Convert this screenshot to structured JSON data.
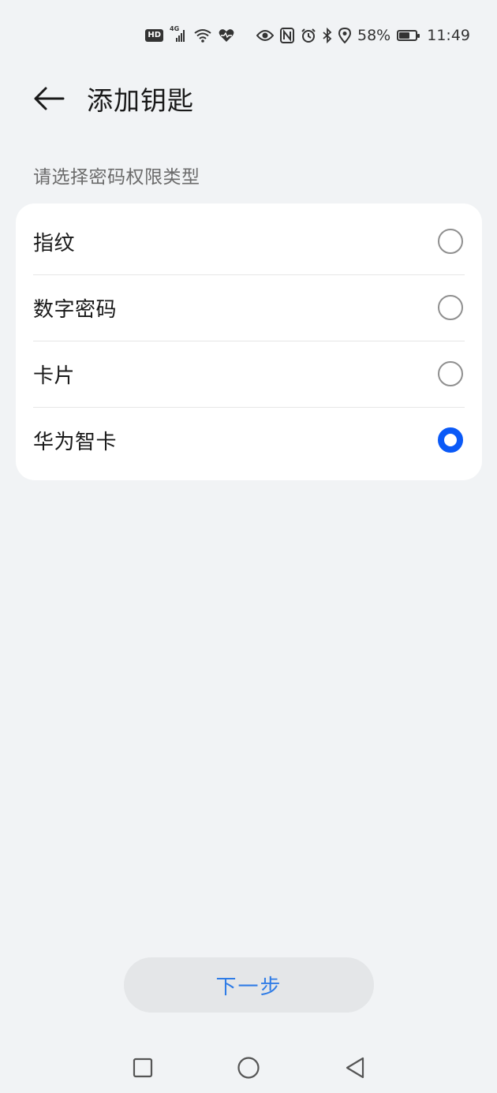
{
  "status_bar": {
    "hd_label": "HD",
    "network_label": "4G",
    "battery_text": "58%",
    "battery_level": 0.58,
    "time": "11:49",
    "icons": [
      "hd-icon",
      "cellular-signal-icon",
      "wifi-icon",
      "health-heart-icon",
      "eye-comfort-icon",
      "nfc-icon",
      "alarm-icon",
      "bluetooth-icon",
      "location-icon",
      "battery-icon"
    ]
  },
  "header": {
    "title": "添加钥匙",
    "back_icon": "arrow-left-icon"
  },
  "section": {
    "label": "请选择密码权限类型"
  },
  "options": [
    {
      "label": "指纹",
      "selected": false
    },
    {
      "label": "数字密码",
      "selected": false
    },
    {
      "label": "卡片",
      "selected": false
    },
    {
      "label": "华为智卡",
      "selected": true
    }
  ],
  "footer": {
    "next_label": "下一步"
  },
  "navigation": {
    "icons": [
      "recent-apps-square-icon",
      "home-circle-icon",
      "back-triangle-icon"
    ]
  },
  "colors": {
    "background": "#f1f3f5",
    "accent": "#0a59f7",
    "button_text": "#2f7ce6"
  }
}
